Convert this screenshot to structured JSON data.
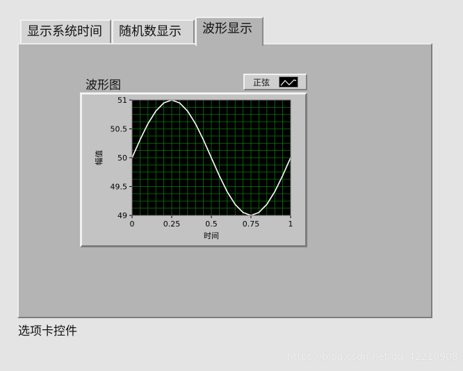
{
  "tabs": [
    {
      "label": "显示系统时间",
      "active": false
    },
    {
      "label": "随机数显示",
      "active": false
    },
    {
      "label": "波形显示",
      "active": true
    }
  ],
  "graph": {
    "label": "波形图",
    "legend": {
      "series_name": "正弦"
    }
  },
  "colors": {
    "plot_bg": "#000000",
    "grid": "#0a7a0a",
    "trace": "#ffffff",
    "panel": "#b4b4b4"
  },
  "chart_data": {
    "type": "line",
    "xlabel": "时间",
    "ylabel": "幅值",
    "xlim": [
      0,
      1
    ],
    "ylim": [
      49,
      51
    ],
    "x_ticks": [
      "0",
      "0.25",
      "0.5",
      "0.75",
      "1"
    ],
    "y_ticks": [
      "51",
      "50.5",
      "50",
      "49.5",
      "49"
    ],
    "grid": true,
    "series": [
      {
        "name": "正弦",
        "x": [
          0,
          0.05,
          0.1,
          0.15,
          0.2,
          0.25,
          0.3,
          0.35,
          0.4,
          0.45,
          0.5,
          0.55,
          0.6,
          0.65,
          0.7,
          0.75,
          0.8,
          0.85,
          0.9,
          0.95,
          1
        ],
        "y": [
          50,
          50.31,
          50.59,
          50.81,
          50.95,
          51,
          50.95,
          50.81,
          50.59,
          50.31,
          50,
          49.69,
          49.41,
          49.19,
          49.05,
          49,
          49.05,
          49.19,
          49.41,
          49.69,
          50
        ]
      }
    ]
  },
  "footer": {
    "label": "选项卡控件"
  },
  "watermark": "https://blog.csdn.net/qq_42210908"
}
